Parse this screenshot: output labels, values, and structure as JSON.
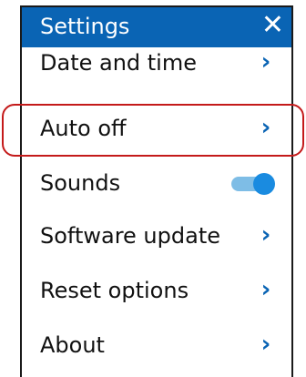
{
  "header": {
    "title": "Settings",
    "close_symbol": "✕"
  },
  "menu": {
    "items": [
      {
        "label": "Date and time",
        "control": "chevron",
        "symbol": "›"
      },
      {
        "label": "Auto off",
        "control": "chevron",
        "symbol": "›",
        "highlighted": true
      },
      {
        "label": "Sounds",
        "control": "toggle",
        "on": true
      },
      {
        "label": "Software update",
        "control": "chevron",
        "symbol": "›"
      },
      {
        "label": "Reset options",
        "control": "chevron",
        "symbol": "›"
      },
      {
        "label": "About",
        "control": "chevron",
        "symbol": "›"
      }
    ]
  },
  "colors": {
    "accent": "#0a64b4",
    "highlight": "#c41a1a",
    "toggle_on": "#1a8be0"
  }
}
